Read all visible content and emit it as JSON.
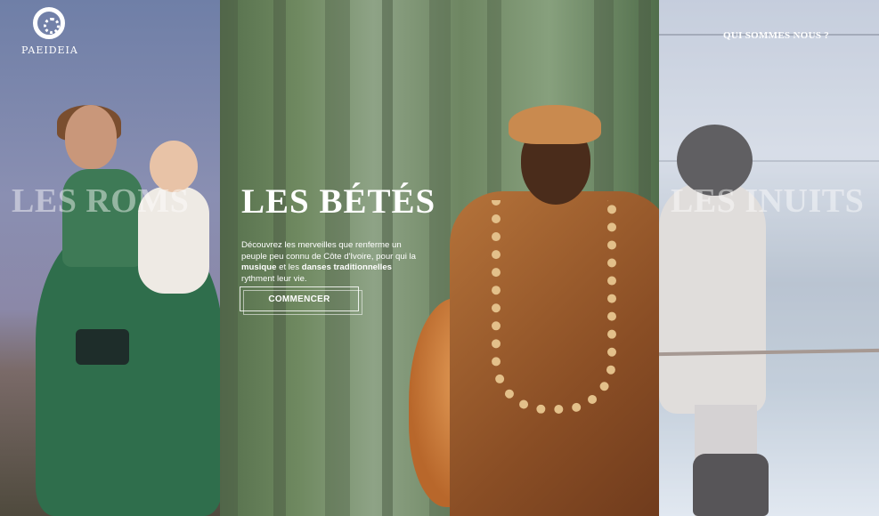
{
  "brand": {
    "name": "PAEIDEIA",
    "icon": "circular-logo-icon"
  },
  "nav": {
    "about_label": "QUI SOMMES NOUS ?"
  },
  "panels": {
    "left": {
      "title": "LES ROMS"
    },
    "center": {
      "title": "LES BÉTÉS",
      "description_part1": "Découvrez les merveilles que renferme un peuple peu connu de Côte d'Ivoire, pour qui la ",
      "description_bold1": "musique",
      "description_part2": " et les ",
      "description_bold2": "danses traditionnelles",
      "description_part3": " rythment leur vie.",
      "cta_label": "COMMENCER"
    },
    "right": {
      "title": "LES INUITS"
    }
  },
  "colors": {
    "text": "#ffffff",
    "faded_title": "rgba(255,255,255,0.45)"
  }
}
